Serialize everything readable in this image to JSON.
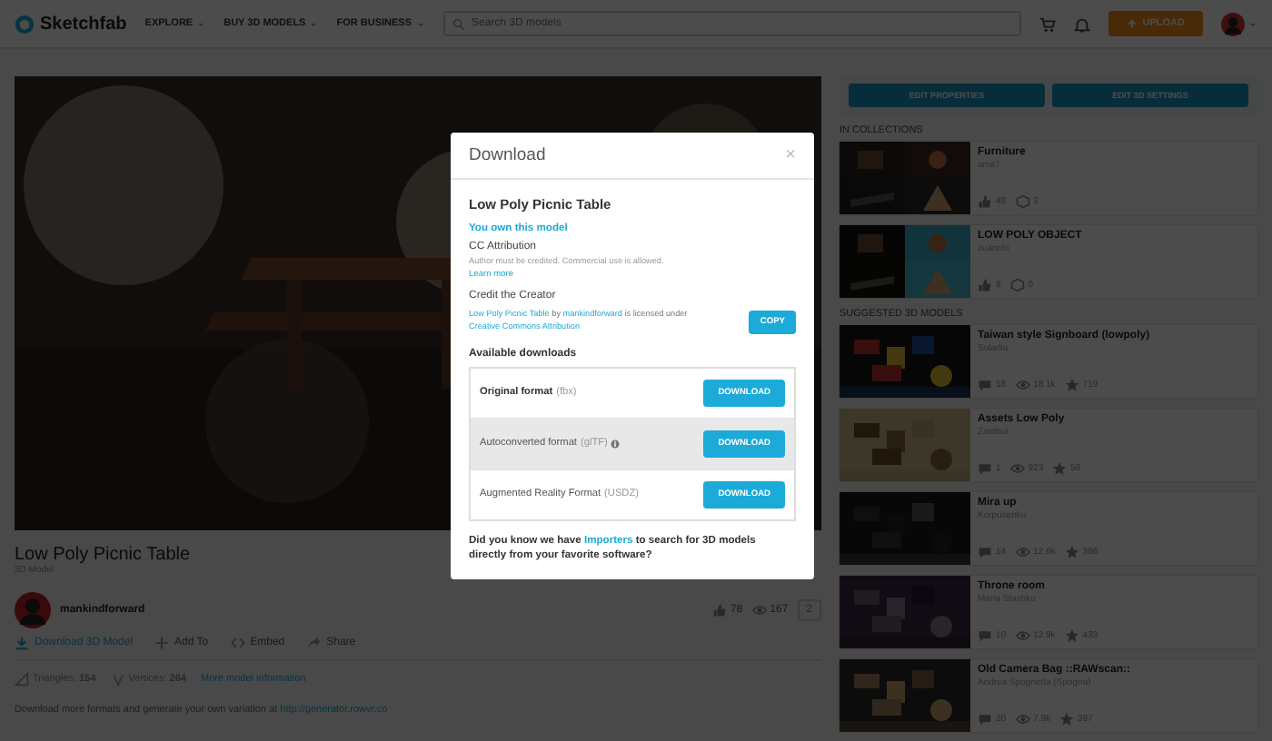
{
  "header": {
    "logo": "Sketchfab",
    "nav": [
      {
        "label": "EXPLORE"
      },
      {
        "label": "BUY 3D MODELS"
      },
      {
        "label": "FOR BUSINESS"
      }
    ],
    "search": {
      "placeholder": "Search 3D models"
    },
    "upload": "UPLOAD"
  },
  "model": {
    "title": "Low Poly Picnic Table",
    "subtitle": "3D Model",
    "author": "mankindforward",
    "stats": [
      {
        "kind": "likes",
        "value": "78"
      },
      {
        "kind": "views",
        "value": "167"
      }
    ],
    "count": "2",
    "actions": [
      {
        "kind": "download",
        "label": "Download 3D Model"
      },
      {
        "kind": "add",
        "label": "Add To"
      },
      {
        "kind": "embed",
        "label": "Embed"
      },
      {
        "kind": "share",
        "label": "Share"
      }
    ],
    "info": [
      {
        "kind": "triangles",
        "label": "Triangles:",
        "value": "154"
      },
      {
        "kind": "vertices",
        "label": "Vertices:",
        "value": "264"
      }
    ],
    "info_link": "More model information",
    "description": {
      "text": "Download more formats and generate your own variation at",
      "link": "http://generator.rowvr.co"
    }
  },
  "sidebar": {
    "buttons": [
      "EDIT PROPERTIES",
      "EDIT 3D SETTINGS"
    ],
    "sections": [
      {
        "heading": "IN COLLECTIONS",
        "items": [
          {
            "kind": "collection",
            "title": "Furniture",
            "author": "amit7",
            "stats": [
              {
                "kind": "likes",
                "value": "48"
              },
              {
                "kind": "models",
                "value": "2"
              }
            ]
          },
          {
            "kind": "collection",
            "title": "LOW POLY OBJECT",
            "author": "xuanchi",
            "stats": [
              {
                "kind": "likes",
                "value": "8"
              },
              {
                "kind": "models",
                "value": "0"
              }
            ]
          }
        ]
      },
      {
        "heading": "SUGGESTED 3D MODELS",
        "items": [
          {
            "kind": "model",
            "title": "Taiwan style Signboard (lowpoly)",
            "author": "Solarliu",
            "stats": [
              {
                "kind": "comments",
                "value": "18"
              },
              {
                "kind": "views",
                "value": "18.1k"
              },
              {
                "kind": "stars",
                "value": "719"
              }
            ]
          },
          {
            "kind": "model",
            "title": "Assets Low Poly",
            "author": "Zambur",
            "stats": [
              {
                "kind": "comments",
                "value": "1"
              },
              {
                "kind": "views",
                "value": "923"
              },
              {
                "kind": "stars",
                "value": "58"
              }
            ]
          },
          {
            "kind": "model",
            "title": "Mira up",
            "author": "Korpusenko",
            "stats": [
              {
                "kind": "comments",
                "value": "14"
              },
              {
                "kind": "views",
                "value": "12.6k"
              },
              {
                "kind": "stars",
                "value": "386"
              }
            ]
          },
          {
            "kind": "model",
            "title": "Throne room",
            "author": "Maria Stashko",
            "stats": [
              {
                "kind": "comments",
                "value": "10"
              },
              {
                "kind": "views",
                "value": "12.9k"
              },
              {
                "kind": "stars",
                "value": "433"
              }
            ]
          },
          {
            "kind": "model",
            "title": "Old Camera Bag ::RAWscan::",
            "author": "Andrea Spognetta (Spogna)",
            "stats": [
              {
                "kind": "comments",
                "value": "20"
              },
              {
                "kind": "views",
                "value": "7.9k"
              },
              {
                "kind": "stars",
                "value": "397"
              }
            ]
          }
        ]
      }
    ]
  },
  "modal": {
    "title": "Download",
    "close": "×",
    "model_name": "Low Poly Picnic Table",
    "ownership": "You own this model",
    "license": {
      "name": "CC Attribution",
      "note": "Author must be credited. Commercial use is allowed.",
      "link": "Learn more"
    },
    "credit": {
      "heading": "Credit the Creator",
      "parts": [
        {
          "text": "Low Poly Picnic Table",
          "link": true
        },
        {
          "text": " by ",
          "link": false
        },
        {
          "text": "mankindforward",
          "link": true
        },
        {
          "text": " is licensed under ",
          "link": false
        },
        {
          "text": "Creative Commons Attribution",
          "link": true
        }
      ],
      "button": "COPY"
    },
    "downloads_heading": "Available downloads",
    "downloads": [
      {
        "name": "Original format",
        "ext": "(fbx)",
        "primary": true,
        "highlighted": false,
        "info": false,
        "button": "DOWNLOAD"
      },
      {
        "name": "Autoconverted format",
        "ext": "(glTF)",
        "primary": false,
        "highlighted": true,
        "info": true,
        "button": "DOWNLOAD"
      },
      {
        "name": "Augmented Reality Format",
        "ext": "(USDZ)",
        "primary": false,
        "highlighted": false,
        "info": false,
        "button": "DOWNLOAD"
      }
    ],
    "footer": [
      {
        "text": "Did you know we have ",
        "link": false
      },
      {
        "text": "Importers",
        "link": true
      },
      {
        "text": " to search for 3D models directly from your favorite software?",
        "link": false
      }
    ]
  }
}
